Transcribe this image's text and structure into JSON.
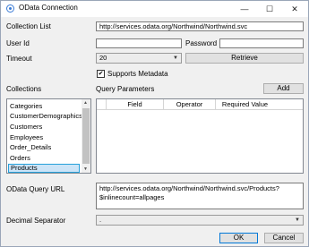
{
  "window": {
    "title": "OData Connection",
    "minimize_glyph": "—",
    "maximize_glyph": "☐",
    "close_glyph": "✕"
  },
  "form": {
    "collection_list_label": "Collection List",
    "collection_list_value": "http://services.odata.org/Northwind/Northwind.svc",
    "user_id_label": "User Id",
    "user_id_value": "",
    "password_label": "Password",
    "password_value": "",
    "timeout_label": "Timeout",
    "timeout_value": "20",
    "retrieve_label": "Retrieve",
    "supports_metadata_label": "Supports Metadata",
    "supports_metadata_checked": true,
    "check_glyph": "✔"
  },
  "collections": {
    "label": "Collections",
    "items": [
      "Categories",
      "CustomerDemographics",
      "Customers",
      "Employees",
      "Order_Details",
      "Orders",
      "Products"
    ],
    "selected": "Products"
  },
  "query_parameters": {
    "label": "Query Parameters",
    "add_label": "Add",
    "columns": [
      "Field",
      "Operator",
      "Required Value"
    ]
  },
  "odata_query": {
    "label": "OData Query URL",
    "line1": "http://services.odata.org/Northwind/Northwind.svc/Products?",
    "line2": "$inlinecount=allpages"
  },
  "decimal_separator": {
    "label": "Decimal Separator",
    "value": "."
  },
  "buttons": {
    "ok_label": "OK",
    "cancel_label": "Cancel"
  }
}
